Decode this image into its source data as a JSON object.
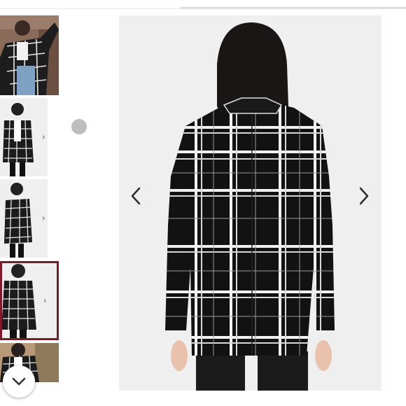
{
  "gallery": {
    "thumbnails": [
      {
        "name": "thumbnail-model-front-outdoor",
        "selected": false
      },
      {
        "name": "thumbnail-model-front",
        "selected": false
      },
      {
        "name": "thumbnail-model-side",
        "selected": false
      },
      {
        "name": "thumbnail-model-back",
        "selected": true
      },
      {
        "name": "thumbnail-model-outdoor",
        "selected": false
      }
    ],
    "thumbnail_arrow_icon": "chevron-right-icon",
    "scroll_down_icon": "chevron-down-icon",
    "prev_icon": "chevron-left-icon",
    "next_icon": "chevron-right-icon",
    "selected_border_color": "#7a1b2a",
    "indicator_dot_color": "#bdbdbd"
  }
}
